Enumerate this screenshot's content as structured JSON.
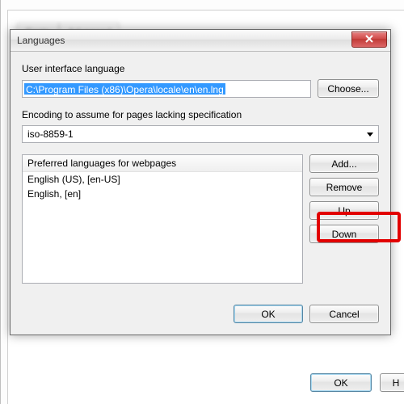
{
  "parent": {
    "tabs": [
      "Fonts",
      "Advanced"
    ],
    "ok": "OK",
    "help": "H"
  },
  "dialog": {
    "title": "Languages",
    "ui_lang_label": "User interface language",
    "ui_lang_path": "C:\\Program Files (x86)\\Opera\\locale\\en\\en.lng",
    "choose": "Choose...",
    "encoding_label": "Encoding to assume for pages lacking specification",
    "encoding_value": "iso-8859-1",
    "list_header": "Preferred languages for webpages",
    "list_items": [
      "English (US), [en-US]",
      "English, [en]"
    ],
    "add": "Add...",
    "remove": "Remove",
    "up": "Up",
    "down": "Down",
    "ok": "OK",
    "cancel": "Cancel"
  }
}
